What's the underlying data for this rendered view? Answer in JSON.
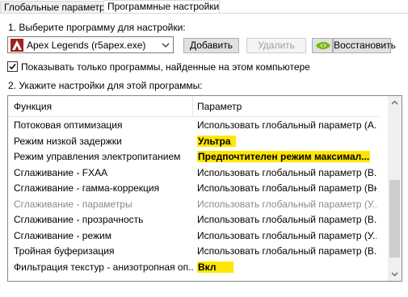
{
  "tabs": [
    {
      "label": "Глобальные параметры"
    },
    {
      "label": "Программные настройки"
    }
  ],
  "section1": {
    "label": "1. Выберите программу для настройки:"
  },
  "program": {
    "selected": "Apex Legends (r5apex.exe)"
  },
  "buttons": {
    "add": "Добавить",
    "remove": "Удалить",
    "restore": "Восстановить"
  },
  "checkbox": {
    "label": "Показывать только программы, найденные на этом компьютере",
    "checked": true
  },
  "section2": {
    "label": "2. Укажите настройки для этой программы:"
  },
  "table": {
    "headers": {
      "function": "Функция",
      "parameter": "Параметр"
    },
    "rows": [
      {
        "function": "Потоковая оптимизация",
        "parameter": "Использовать глобальный параметр (А..."
      },
      {
        "function": "Режим низкой задержки",
        "parameter": "Ультра"
      },
      {
        "function": "Режим управления электропитанием",
        "parameter": "Предпочтителен режим максимал..."
      },
      {
        "function": "Сглаживание - FXAA",
        "parameter": "Использовать глобальный параметр (В..."
      },
      {
        "function": "Сглаживание - гамма-коррекция",
        "parameter": "Использовать глобальный параметр (Вкл)"
      },
      {
        "function": "Сглаживание - параметры",
        "parameter": "Использовать глобальный параметр (У..."
      },
      {
        "function": "Сглаживание - прозрачность",
        "parameter": "Использовать глобальный параметр (В..."
      },
      {
        "function": "Сглаживание - режим",
        "parameter": "Использовать глобальный параметр (У..."
      },
      {
        "function": "Тройная буферизация",
        "parameter": "Использовать глобальный параметр (В..."
      },
      {
        "function": "Фильтрация текстур - анизотропная оп...",
        "parameter": "Вкл"
      }
    ]
  },
  "colors": {
    "highlight": "#ffe600",
    "nvidia_green": "#76b900",
    "apex_red": "#a02020"
  }
}
